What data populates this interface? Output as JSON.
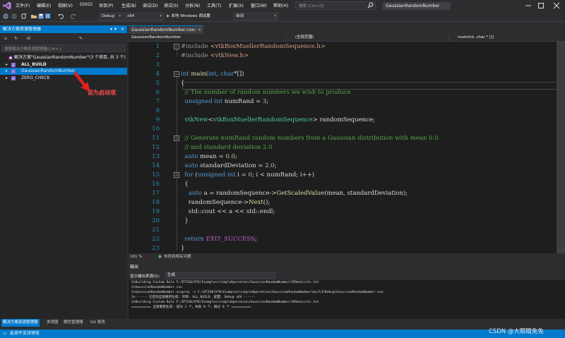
{
  "menubar": {
    "items": [
      "文件(F)",
      "编辑(E)",
      "视图(V)",
      "Git(G)",
      "项目(P)",
      "生成(B)",
      "调试(D)",
      "测试(S)",
      "分析(N)",
      "工具(T)",
      "扩展(X)",
      "窗口(W)",
      "帮助(H)"
    ],
    "search_placeholder": "搜索 (Ctrl+Q)",
    "app_title": "GaussianRandomNumber"
  },
  "toolbar": {
    "config": "Debug",
    "platform": "x64",
    "run_label": "本地 Windows 调试器",
    "auto": "自动"
  },
  "solution_explorer": {
    "title": "解决方案资源管理器",
    "search_placeholder": "搜索解决方案资源管理器(Ctrl+;)",
    "items": [
      {
        "label": "解决方案\"GaussianRandomNumber\"(3 个项目, 共 3 个)",
        "level": 0,
        "selected": false
      },
      {
        "label": "ALL_BUILD",
        "level": 1,
        "selected": false
      },
      {
        "label": "GaussianRandomNumber",
        "level": 1,
        "selected": true
      },
      {
        "label": "ZERO_CHECK",
        "level": 1,
        "selected": false
      }
    ],
    "annotation": "设为启动项",
    "tabs": [
      "解决方案资源管理器",
      "类视图",
      "属性管理器",
      "Git 更改"
    ]
  },
  "editor": {
    "tab_label": "GaussianRandomNumber.cxx",
    "nav": [
      "GaussianRandomNumber",
      "(全局范围)",
      "main(int, char * [])"
    ],
    "zoom": "161 %",
    "issues": "未找到相关问题",
    "lines": [
      {
        "n": "1",
        "text": "#include <vtkBoxMuellerRandomSequence.h>"
      },
      {
        "n": "2",
        "text": "#include <vtkNew.h>"
      },
      {
        "n": "3",
        "text": ""
      },
      {
        "n": "4",
        "text": "int main(int, char*[])"
      },
      {
        "n": "5",
        "text": "{"
      },
      {
        "n": "6",
        "text": "  // The number of random numbers we wish to produce"
      },
      {
        "n": "7",
        "text": "  unsigned int numRand = 3;"
      },
      {
        "n": "8",
        "text": ""
      },
      {
        "n": "9",
        "text": "  vtkNew<vtkBoxMuellerRandomSequence> randomSequence;"
      },
      {
        "n": "10",
        "text": ""
      },
      {
        "n": "11",
        "text": "  // Generate numRand random numbers from a Gaussian distribution with mean 0.0"
      },
      {
        "n": "12",
        "text": "  // and standard deviation 2.0"
      },
      {
        "n": "13",
        "text": "  auto mean = 0.0;"
      },
      {
        "n": "14",
        "text": "  auto standardDeviation = 2.0;"
      },
      {
        "n": "15",
        "text": "  for (unsigned int i = 0; i < numRand; i++)"
      },
      {
        "n": "16",
        "text": "  {"
      },
      {
        "n": "17",
        "text": "    auto a = randomSequence->GetScaledValue(mean, standardDeviation);"
      },
      {
        "n": "18",
        "text": "    randomSequence->Next();"
      },
      {
        "n": "19",
        "text": "    std::cout << a << std::endl;"
      },
      {
        "n": "20",
        "text": "  }"
      },
      {
        "n": "21",
        "text": ""
      },
      {
        "n": "22",
        "text": "  return EXIT_SUCCESS;"
      },
      {
        "n": "23",
        "text": "}"
      }
    ]
  },
  "output": {
    "title": "输出",
    "source_label": "显示输出来源(S):",
    "source_value": "生成",
    "lines": [
      "2>Building Custom Rule F:/DTIS0/VTK/Examples/simpleOperation/GaussianRandomNumber/CMakeLists.txt",
      "2>GaussianRandomNumber.cxx",
      "2>GaussianRandomNumber.vcxproj -> F:\\DTIS0\\VTK\\Examples\\simpleOperation\\GaussianRandomNumber\\build\\Debug\\GaussianRandomNumber.exe",
      "3>------ 已启动全部重新生成: 项目: ALL_BUILD, 配置: Debug x64 ------",
      "3>Building Custom Rule F:/DTIS0/VTK/Examples/simpleOperation/GaussianRandomNumber/CMakeLists.txt",
      "========== 全部重新生成: 成功 3 个，失败 0 个，跳过 0 个 =========="
    ]
  },
  "statusbar": {
    "text": "此项不支持预览"
  },
  "watermark": "CSDN @大眼睛免免"
}
